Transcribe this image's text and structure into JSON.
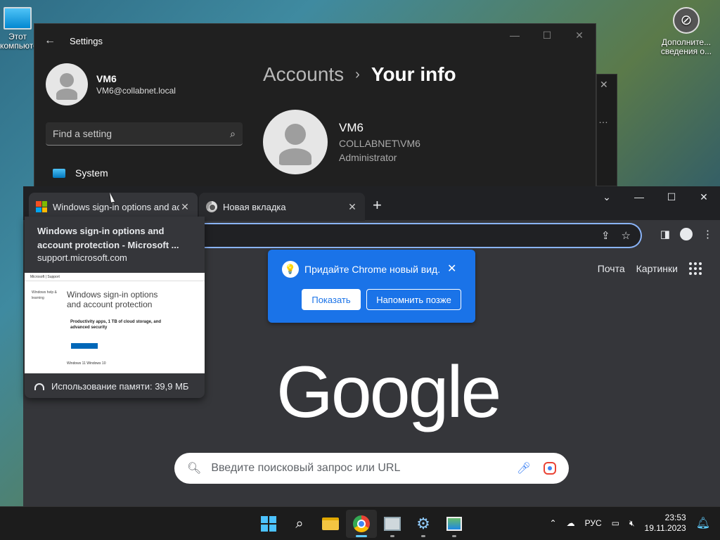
{
  "desktop": {
    "left_icon_label": "Этот компьютер",
    "right_icon_label": "Дополните... сведения о..."
  },
  "settings": {
    "title": "Settings",
    "user_name": "VM6",
    "user_email": "VM6@collabnet.local",
    "search_placeholder": "Find a setting",
    "nav_system": "System",
    "breadcrumb_parent": "Accounts",
    "breadcrumb_current": "Your info",
    "profile_name": "VM6",
    "profile_account": "COLLABNET\\VM6",
    "profile_role": "Administrator"
  },
  "chrome": {
    "tabs": [
      {
        "label": "Windows sign-in options and account protection - Microsoft Support"
      },
      {
        "label": "Новая вкладка"
      }
    ],
    "links": {
      "mail": "Почта",
      "images": "Картинки"
    },
    "google_logo": "Google",
    "search_placeholder": "Введите поисковый запрос или URL",
    "promo": {
      "text": "Придайте Chrome новый вид.",
      "show": "Показать",
      "later": "Напомнить позже"
    },
    "hovercard": {
      "title": "Windows sign-in options and account protection - Microsoft ...",
      "domain": "support.microsoft.com",
      "thumb_heading": "Windows sign-in options and account protection",
      "thumb_promo": "Productivity apps, 1 TB of cloud storage, and advanced security",
      "thumb_side": "Windows help & learning",
      "thumb_tabs": "Windows 11     Windows 10",
      "memory": "Использование памяти: 39,9 МБ"
    }
  },
  "taskbar": {
    "lang": "РУС",
    "time": "23:53",
    "date": "19.11.2023"
  },
  "colors": {
    "accent_blue": "#1a73e8",
    "omnibox_focus": "#8ab4f8",
    "taskbar_active": "#60cdff"
  }
}
